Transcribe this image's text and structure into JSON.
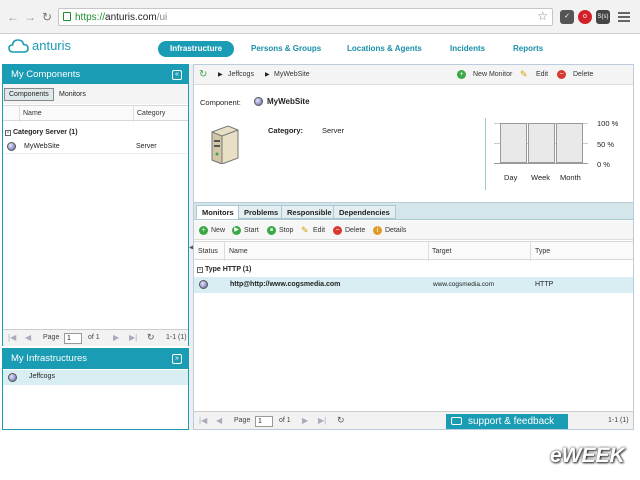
{
  "browser": {
    "url_scheme": "https://",
    "url_host": "anturis.com",
    "url_path": "/ui",
    "ext_badge": "S(s)"
  },
  "app": {
    "logo_text": "anturis",
    "nav": [
      {
        "label": "Infrastructure",
        "active": true
      },
      {
        "label": "Persons & Groups"
      },
      {
        "label": "Locations & Agents"
      },
      {
        "label": "Incidents"
      },
      {
        "label": "Reports"
      }
    ]
  },
  "left": {
    "components": {
      "title": "My Components",
      "tabs": [
        "Components",
        "Monitors"
      ],
      "columns": [
        "Name",
        "Category"
      ],
      "group": "Category Server (1)",
      "rows": [
        {
          "name": "MyWebSite",
          "category": "Server"
        }
      ],
      "pager": {
        "page_label": "Page",
        "page": "1",
        "of": "of 1",
        "range": "1-1 (1)"
      }
    },
    "infrastructures": {
      "title": "My Infrastructures",
      "items": [
        "Jeffcogs"
      ]
    }
  },
  "main": {
    "breadcrumb": [
      "Jeffcogs",
      "MyWebSite"
    ],
    "actions": {
      "new_monitor": "New Monitor",
      "edit": "Edit",
      "delete": "Delete"
    },
    "component_label": "Component:",
    "component_name": "MyWebSite",
    "category_label": "Category:",
    "category_value": "Server",
    "availability": {
      "axis_labels": [
        "100 %",
        "50 %",
        "0 %"
      ],
      "bars": [
        {
          "label": "Day",
          "value": 100
        },
        {
          "label": "Week",
          "value": 100
        },
        {
          "label": "Month",
          "value": 100
        }
      ]
    },
    "tabs": [
      "Monitors",
      "Problems",
      "Responsible",
      "Dependencies"
    ],
    "monitor_toolbar": {
      "new": "New",
      "start": "Start",
      "stop": "Stop",
      "edit": "Edit",
      "delete": "Delete",
      "details": "Details"
    },
    "columns": [
      "Status",
      "Name",
      "Target",
      "Type"
    ],
    "group": "Type HTTP (1)",
    "rows": [
      {
        "name": "http@http://www.cogsmedia.com",
        "target": "www.cogsmedia.com",
        "type": "HTTP"
      }
    ],
    "pager": {
      "page_label": "Page",
      "page": "1",
      "of": "of 1",
      "range": "1-1 (1)"
    }
  },
  "feedback": {
    "label": "support & feedback"
  },
  "watermark": "eWEEK",
  "colors": {
    "accent": "#1a9cb4",
    "selected_row": "#d9eef2"
  }
}
